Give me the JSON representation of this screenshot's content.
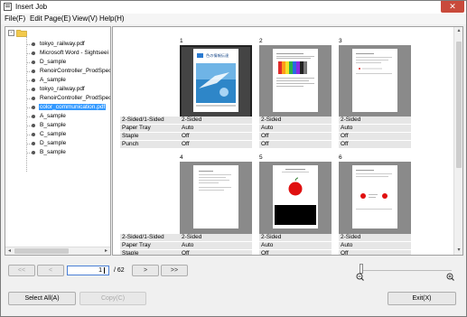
{
  "window": {
    "title": "Insert Job",
    "close_label": "✕"
  },
  "menu": [
    "File(F)",
    "Edit Page(E)",
    "View(V)",
    "Help(H)"
  ],
  "tree": {
    "expander": "-",
    "items": [
      "tokyo_railway.pdf",
      "Microsoft Word - Sightseei",
      "D_sample",
      "RenoirController_ProdSpec_",
      "A_sample",
      "tokyo_railway.pdf",
      "RenoirController_ProdSpec_",
      "color_communication.pdf",
      "A_sample",
      "B_sample",
      "C_sample",
      "D_sample",
      "B_sample"
    ],
    "selected_index": 7,
    "scroll_left": "◂",
    "scroll_right": "▸"
  },
  "main": {
    "scroll_up": "▴",
    "scroll_down": "▾",
    "prop_labels": [
      "2-Sided/1-Sided",
      "Paper Tray",
      "Staple",
      "Punch"
    ],
    "pages": [
      {
        "num": "1",
        "values": [
          "2-Sided",
          "Auto",
          "Off",
          "Off"
        ],
        "selected": true
      },
      {
        "num": "2",
        "values": [
          "2-Sided",
          "Auto",
          "Off",
          "Off"
        ],
        "selected": false
      },
      {
        "num": "3",
        "values": [
          "2-Sided",
          "Auto",
          "Off",
          "Off"
        ],
        "selected": false
      },
      {
        "num": "4",
        "values": [
          "2-Sided",
          "Auto",
          "Off"
        ],
        "selected": false
      },
      {
        "num": "5",
        "values": [
          "2-Sided",
          "Auto",
          "Off"
        ],
        "selected": false
      },
      {
        "num": "6",
        "values": [
          "2-Sided",
          "Auto",
          "Off"
        ],
        "selected": false
      }
    ],
    "page1_heading": "色の情報伝達"
  },
  "nav": {
    "first": "<<",
    "prev": "<",
    "next": ">",
    "last": ">>",
    "current_page": "1",
    "total": "/ 62"
  },
  "zoom": {
    "level": 0.0
  },
  "footer": {
    "select_all": "Select All(A)",
    "copy": "Copy(C)",
    "exit": "Exit(X)"
  },
  "colors": {
    "selection": "#3399ff",
    "close": "#c94a3b",
    "apple_red": "#e01010"
  }
}
